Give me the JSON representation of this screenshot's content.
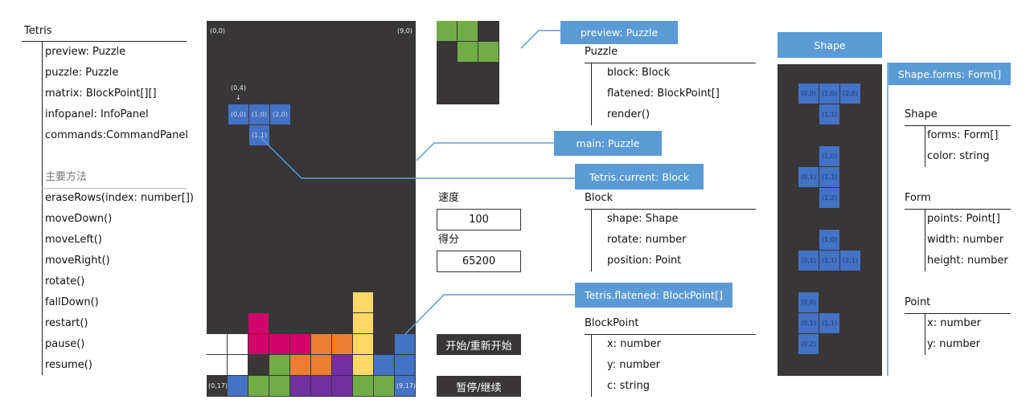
{
  "colors": {
    "board": "#383636",
    "blue": "#4472c4",
    "label": "#5b9bd5",
    "W": "#ffffff",
    "M": "#d0066a",
    "O": "#ed7d31",
    "P": "#7030a0",
    "G": "#70ad47",
    "Y": "#ffd966",
    "B": "#4472c4"
  },
  "tetris": {
    "title": "Tetris",
    "props": [
      "preview: Puzzle",
      "puzzle: Puzzle",
      "matrix: BlockPoint[][]",
      "infopanel: InfoPanel",
      "commands:CommandPanel"
    ],
    "methods_title": "主要方法",
    "methods": [
      "eraseRows(index: number[])",
      "moveDown()",
      "moveLeft()",
      "moveRight()",
      "rotate()",
      "fallDown()",
      "restart()",
      "pause()",
      "resume()"
    ]
  },
  "board": {
    "corner_tl": "(0,0)",
    "corner_tr": "(9,0)",
    "corner_bl": "(0,17)",
    "corner_br": "(9,17)",
    "position_label": "(0,4)",
    "arrow": "↓",
    "current_block": [
      {
        "x": 1,
        "y": 4,
        "t": "(0,0)"
      },
      {
        "x": 2,
        "y": 4,
        "t": "(1,0)"
      },
      {
        "x": 3,
        "y": 4,
        "t": "(2,0)"
      },
      {
        "x": 2,
        "y": 5,
        "t": "(1,1)"
      }
    ],
    "rows": {
      "13": ".......Y..",
      "14": "..M....Y..",
      "15": "WWMMMOOY.B",
      "16": "WW.GOOPYBB",
      "17": ".BGGPPPGGB"
    }
  },
  "preview": {
    "cells": [
      [
        0,
        0
      ],
      [
        1,
        0
      ],
      [
        1,
        1
      ],
      [
        2,
        1
      ]
    ]
  },
  "info": {
    "speed_label": "速度",
    "speed": "100",
    "score_label": "得分",
    "score": "65200",
    "start_button": "开始/重新开始",
    "pause_button": "暂停/继续"
  },
  "labels": {
    "preview": "preview: Puzzle",
    "main": "main: Puzzle",
    "current": "Tetris.current: Block",
    "flatened": "Tetris.flatened: BlockPoint[]",
    "shape": "Shape",
    "forms": "Shape.forms: Form[]"
  },
  "puzzle": {
    "title": "Puzzle",
    "items": [
      "block: Block",
      "flatened: BlockPoint[]",
      "render()"
    ]
  },
  "block": {
    "title": "Block",
    "items": [
      "shape: Shape",
      "rotate: number",
      "position: Point"
    ]
  },
  "blockpoint": {
    "title": "BlockPoint",
    "items": [
      "x: number",
      "y: number",
      "c: string"
    ]
  },
  "shape": {
    "title": "Shape",
    "items": [
      "forms: Form[]",
      "color: string"
    ]
  },
  "form": {
    "title": "Form",
    "items": [
      "points: Point[]",
      "width: number",
      "height: number"
    ]
  },
  "point": {
    "title": "Point",
    "items": [
      "x: number",
      "y: number"
    ]
  },
  "forms": [
    [
      [
        0,
        0
      ],
      [
        1,
        0
      ],
      [
        2,
        0
      ],
      [
        1,
        1
      ]
    ],
    [
      [
        1,
        0
      ],
      [
        0,
        1
      ],
      [
        1,
        1
      ],
      [
        1,
        2
      ]
    ],
    [
      [
        1,
        0
      ],
      [
        0,
        1
      ],
      [
        1,
        1
      ],
      [
        2,
        1
      ]
    ],
    [
      [
        0,
        0
      ],
      [
        0,
        1
      ],
      [
        1,
        1
      ],
      [
        0,
        2
      ]
    ]
  ]
}
